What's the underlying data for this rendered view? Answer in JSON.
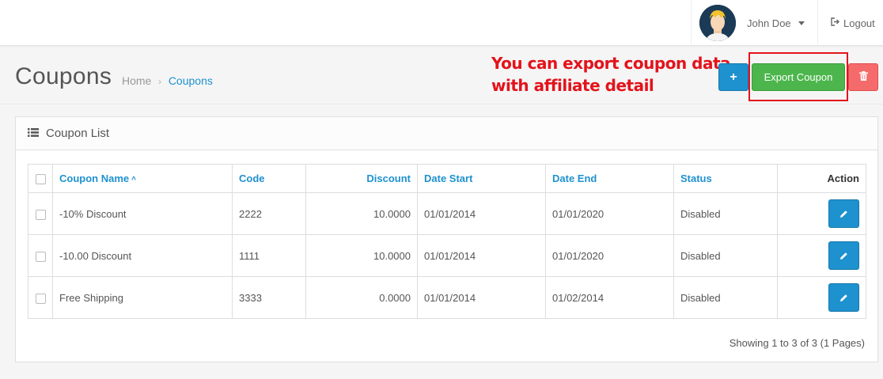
{
  "header": {
    "user_name": "John Doe",
    "logout_label": "Logout"
  },
  "page": {
    "title": "Coupons",
    "breadcrumb": [
      {
        "label": "Home"
      },
      {
        "label": "Coupons"
      }
    ]
  },
  "annotation": {
    "line1": "You can export coupon data",
    "line2": "with affiliate detail"
  },
  "toolbar": {
    "add_icon": "+",
    "export_label": "Export Coupon",
    "delete_icon": "trash-icon"
  },
  "panel": {
    "title": "Coupon List"
  },
  "table": {
    "columns": {
      "name": "Coupon Name",
      "code": "Code",
      "discount": "Discount",
      "date_start": "Date Start",
      "date_end": "Date End",
      "status": "Status",
      "action": "Action"
    },
    "rows": [
      {
        "name": "-10% Discount",
        "code": "2222",
        "discount": "10.0000",
        "date_start": "01/01/2014",
        "date_end": "01/01/2020",
        "status": "Disabled"
      },
      {
        "name": "-10.00 Discount",
        "code": "1111",
        "discount": "10.0000",
        "date_start": "01/01/2014",
        "date_end": "01/01/2020",
        "status": "Disabled"
      },
      {
        "name": "Free Shipping",
        "code": "3333",
        "discount": "0.0000",
        "date_start": "01/01/2014",
        "date_end": "01/02/2014",
        "status": "Disabled"
      }
    ]
  },
  "pagination": {
    "info": "Showing 1 to 3 of 3 (1 Pages)"
  },
  "colors": {
    "primary": "#1e91cf",
    "success": "#4cb64c",
    "danger": "#f56b6b",
    "annotation": "#e3131b"
  }
}
